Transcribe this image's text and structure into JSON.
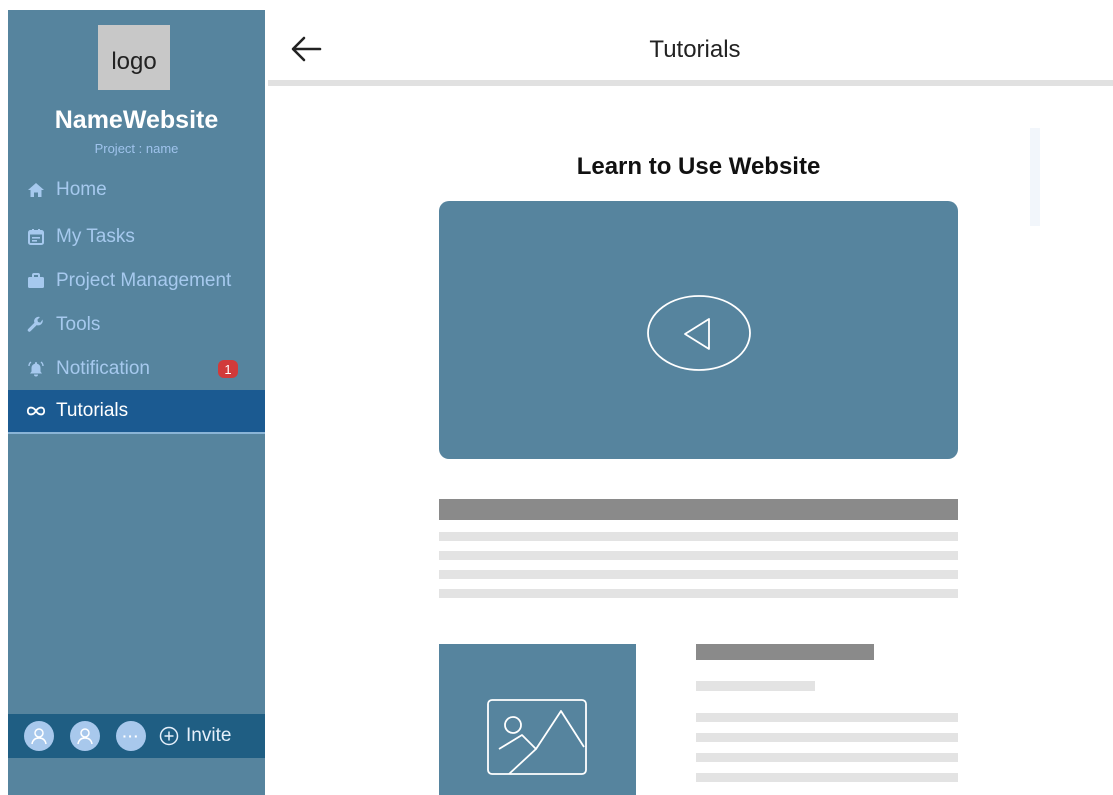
{
  "sidebar": {
    "logo_text": "logo",
    "site_name": "NameWebsite",
    "project_label": "Project : name",
    "items": [
      {
        "label": "Home",
        "icon": "home-icon"
      },
      {
        "label": "My Tasks",
        "icon": "calendar-icon"
      },
      {
        "label": "Project Management",
        "icon": "briefcase-icon"
      },
      {
        "label": "Tools",
        "icon": "wrench-icon"
      },
      {
        "label": "Notification",
        "icon": "bell-icon",
        "badge": "1"
      },
      {
        "label": "Tutorials",
        "icon": "infinity-icon",
        "active": true
      }
    ],
    "footer": {
      "invite_label": "Invite",
      "more_label": "···"
    }
  },
  "header": {
    "title": "Tutorials"
  },
  "content": {
    "title": "Learn to Use Website"
  },
  "colors": {
    "sidebar_bg": "#56849e",
    "active_item_bg": "#1b5a91",
    "badge": "#d13a3a",
    "video_bg": "#56849e"
  }
}
